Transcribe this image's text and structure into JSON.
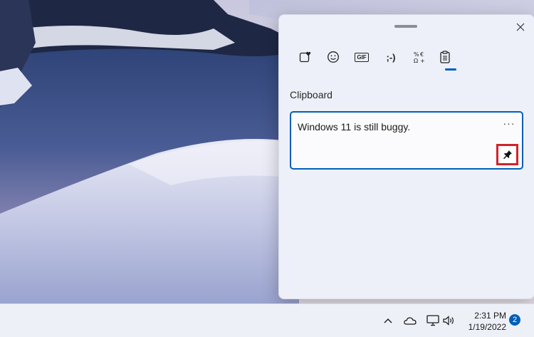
{
  "clipboard_panel": {
    "section_title": "Clipboard",
    "tabs": [
      {
        "icon": "favorites-heart-icon",
        "label": ""
      },
      {
        "icon": "smiley-emoji-icon",
        "label": ""
      },
      {
        "icon": "gif-icon",
        "label": "GIF"
      },
      {
        "icon": "kaomoji-icon",
        "label": ";-)"
      },
      {
        "icon": "symbols-icon",
        "label": ""
      },
      {
        "icon": "clipboard-icon",
        "label": ""
      }
    ],
    "active_tab": "clipboard",
    "items": [
      {
        "text": "Windows 11 is still buggy.",
        "more_label": "···"
      }
    ]
  },
  "taskbar": {
    "time": "2:31 PM",
    "date": "1/19/2022",
    "notification_count": "2",
    "tray_icons": [
      "chevron-up-icon",
      "onedrive-cloud-icon",
      "network-icon",
      "volume-icon"
    ]
  },
  "colors": {
    "accent": "#005fb8",
    "highlight_box": "#d1232a",
    "panel_bg": "#edf0f8"
  }
}
